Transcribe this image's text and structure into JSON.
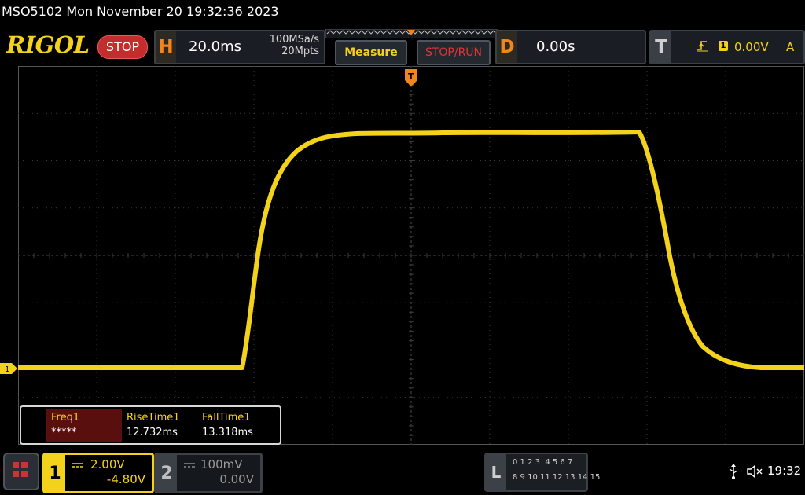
{
  "title_bar": {
    "text": "MSO5102  Mon November 20 19:32:36 2023"
  },
  "header": {
    "brand": "RIGOL",
    "run_state": "STOP",
    "horizontal": {
      "letter": "H",
      "timebase": "20.0ms",
      "sample_rate": "100MSa/s",
      "memory_depth": "20Mpts"
    },
    "measure_label": "Measure",
    "stoprun_label": "STOP/RUN",
    "delay": {
      "letter": "D",
      "value": "0.00s"
    },
    "trigger": {
      "letter": "T",
      "source": "1",
      "level": "0.00V",
      "mode": "A",
      "icon": "rising-edge-icon"
    }
  },
  "markers": {
    "ch1_ground_label": "1",
    "trigger_time_label": "T"
  },
  "measurements": [
    {
      "name": "Freq1",
      "value": "*****"
    },
    {
      "name": "RiseTime1",
      "value": "12.732ms"
    },
    {
      "name": "FallTime1",
      "value": "13.318ms"
    }
  ],
  "channels": {
    "ch1": {
      "number": "1",
      "scale": "2.00V",
      "offset": "-4.80V",
      "active": true
    },
    "ch2": {
      "number": "2",
      "scale": "100mV",
      "offset": "0.00V",
      "active": false
    }
  },
  "logic": {
    "letter": "L",
    "row1": "0 1 2 3  4 5 6 7",
    "row2": "8 9 10 11 12 13 14 15"
  },
  "status": {
    "clock": "19:32",
    "usb_icon": "usb-icon",
    "speaker_icon": "speaker-muted-icon"
  },
  "colors": {
    "ch1": "#f3d21b",
    "accent_orange": "#f2861c",
    "stop_red": "#c42d2d",
    "grid": "#3a3a3a"
  }
}
